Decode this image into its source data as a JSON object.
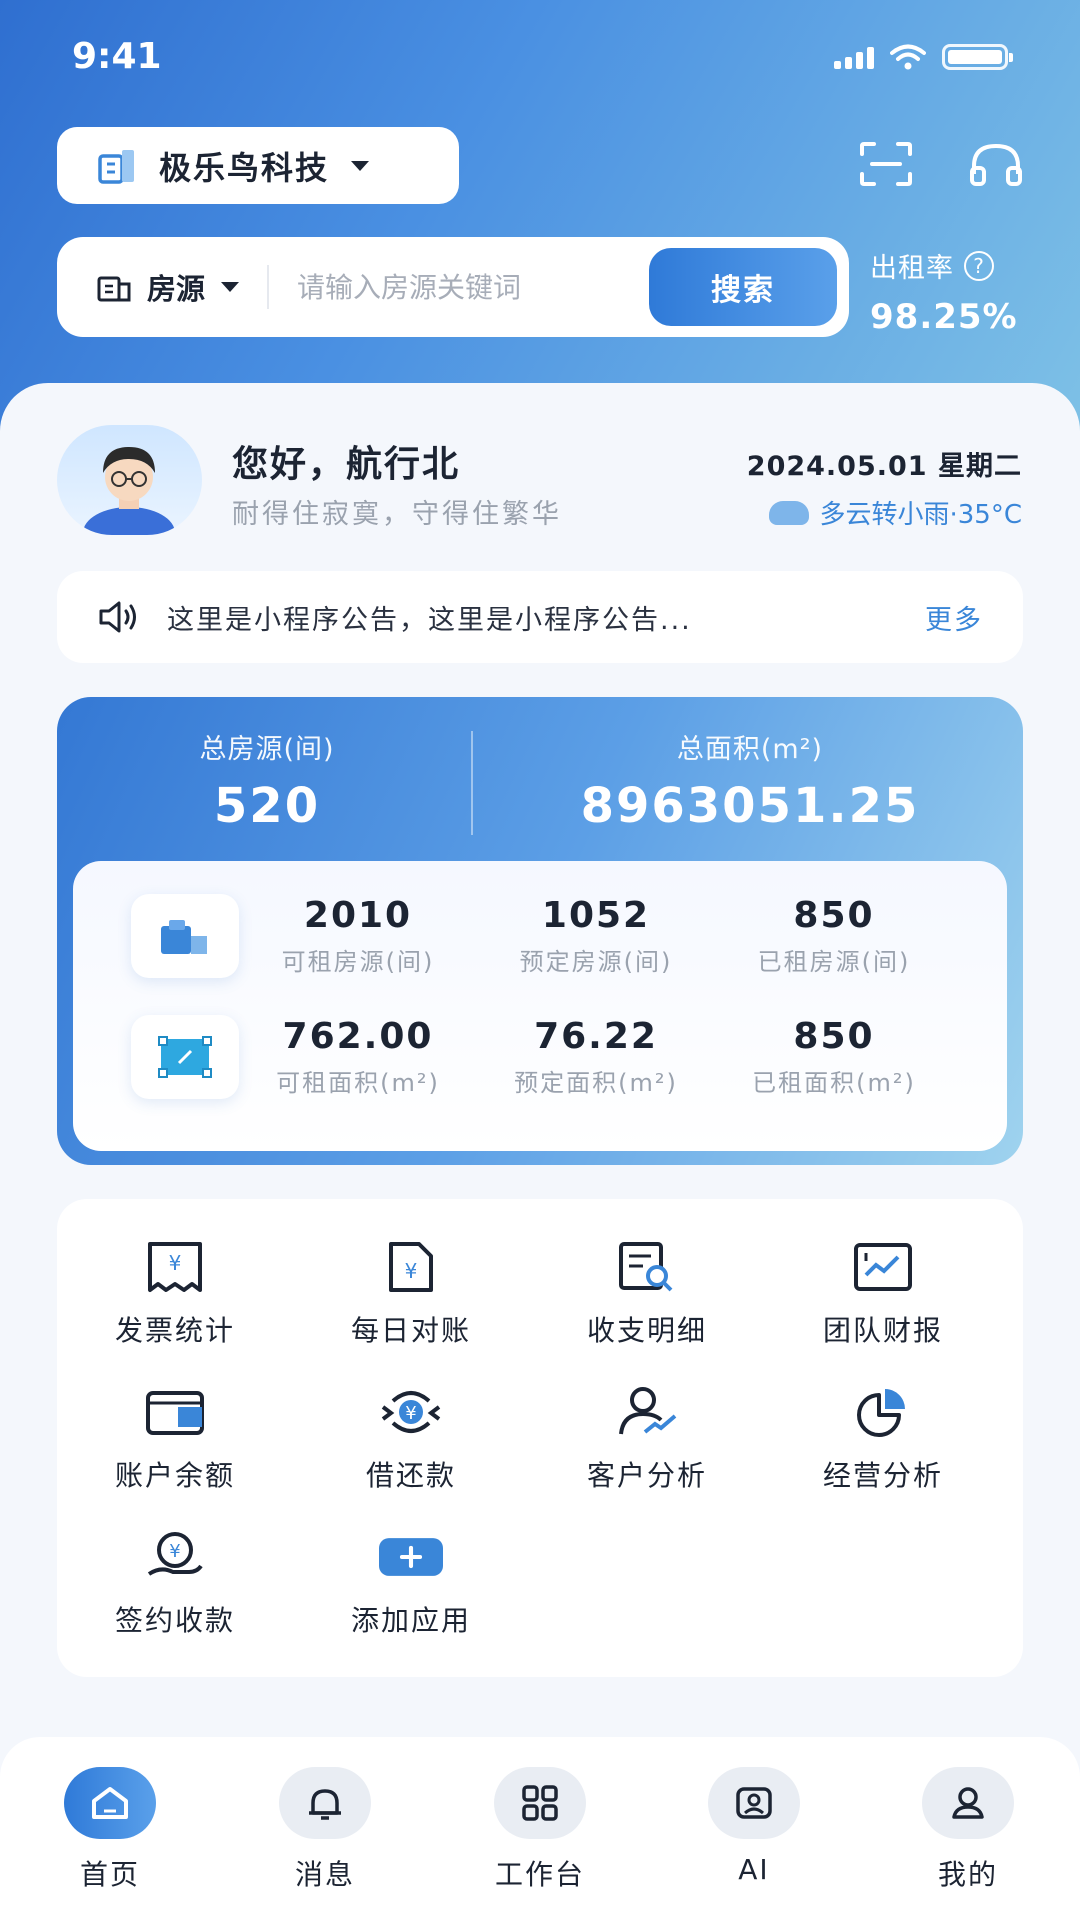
{
  "status_bar": {
    "time": "9:41"
  },
  "header": {
    "company": "极乐鸟科技"
  },
  "search": {
    "type_label": "房源",
    "placeholder": "请输入房源关键词",
    "button": "搜索"
  },
  "occupancy": {
    "label": "出租率",
    "help": "?",
    "value": "98.25%"
  },
  "user": {
    "greeting": "您好，航行北",
    "motto": "耐得住寂寞，守得住繁华",
    "date": "2024.05.01 星期二",
    "weather": "多云转小雨·35°C"
  },
  "notice": {
    "text": "这里是小程序公告，这里是小程序公告...",
    "more": "更多"
  },
  "stats": {
    "total_rooms_label": "总房源(间)",
    "total_rooms": "520",
    "total_area_label": "总面积(m²)",
    "total_area": "8963051.25",
    "rooms": [
      {
        "value": "2010",
        "label": "可租房源(间)"
      },
      {
        "value": "1052",
        "label": "预定房源(间)"
      },
      {
        "value": "850",
        "label": "已租房源(间)"
      }
    ],
    "areas": [
      {
        "value": "762.00",
        "label": "可租面积(m²)"
      },
      {
        "value": "76.22",
        "label": "预定面积(m²)"
      },
      {
        "value": "850",
        "label": "已租面积(m²)"
      }
    ]
  },
  "apps": [
    {
      "label": "发票统计",
      "icon": "invoice-icon"
    },
    {
      "label": "每日对账",
      "icon": "reconcile-icon"
    },
    {
      "label": "收支明细",
      "icon": "statement-icon"
    },
    {
      "label": "团队财报",
      "icon": "report-icon"
    },
    {
      "label": "账户余额",
      "icon": "wallet-icon"
    },
    {
      "label": "借还款",
      "icon": "loan-icon"
    },
    {
      "label": "客户分析",
      "icon": "customer-icon"
    },
    {
      "label": "经营分析",
      "icon": "pie-icon"
    },
    {
      "label": "签约收款",
      "icon": "collect-icon"
    },
    {
      "label": "添加应用",
      "icon": "plus-icon"
    }
  ],
  "tabs": [
    {
      "label": "首页",
      "icon": "home-icon"
    },
    {
      "label": "消息",
      "icon": "bell-icon"
    },
    {
      "label": "工作台",
      "icon": "grid-icon"
    },
    {
      "label": "AI",
      "icon": "ai-icon"
    },
    {
      "label": "我的",
      "icon": "user-icon"
    }
  ],
  "colors": {
    "primary": "#2f7ad8",
    "accent": "#3a86d8",
    "text": "#1c2433",
    "muted": "#9aa2ae"
  }
}
